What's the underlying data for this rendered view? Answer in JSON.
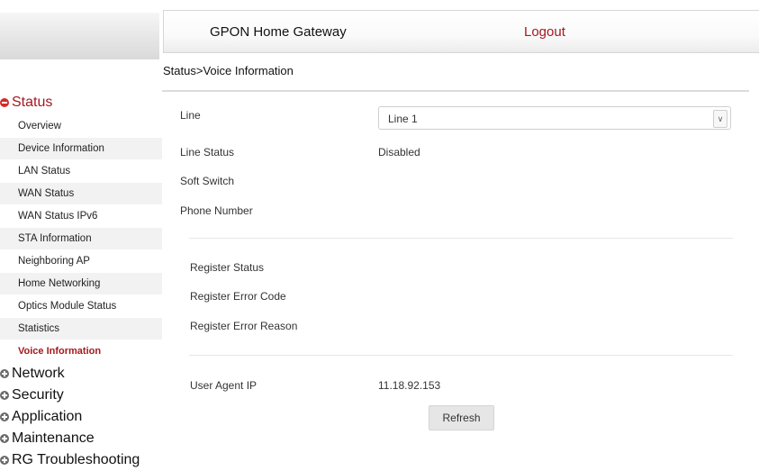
{
  "header": {
    "title": "GPON Home Gateway",
    "logout": "Logout"
  },
  "breadcrumb": "Status>Voice Information",
  "sidebar": {
    "status": {
      "label": "Status",
      "items": [
        "Overview",
        "Device Information",
        "LAN Status",
        "WAN Status",
        "WAN Status IPv6",
        "STA Information",
        "Neighboring AP",
        "Home Networking",
        "Optics Module Status",
        "Statistics",
        "Voice Information"
      ],
      "active": "Voice Information"
    },
    "categories": [
      "Network",
      "Security",
      "Application",
      "Maintenance",
      "RG Troubleshooting"
    ]
  },
  "form": {
    "line_label": "Line",
    "line_value": "Line 1",
    "line_status_label": "Line Status",
    "line_status_value": "Disabled",
    "soft_switch_label": "Soft Switch",
    "phone_number_label": "Phone Number",
    "register_status_label": "Register Status",
    "register_error_code_label": "Register Error Code",
    "register_error_reason_label": "Register Error Reason",
    "user_agent_ip_label": "User Agent IP",
    "user_agent_ip_value": "11.18.92.153",
    "refresh_label": "Refresh"
  },
  "colors": {
    "accent": "#a31920",
    "status_icon": "#d52b2b"
  }
}
